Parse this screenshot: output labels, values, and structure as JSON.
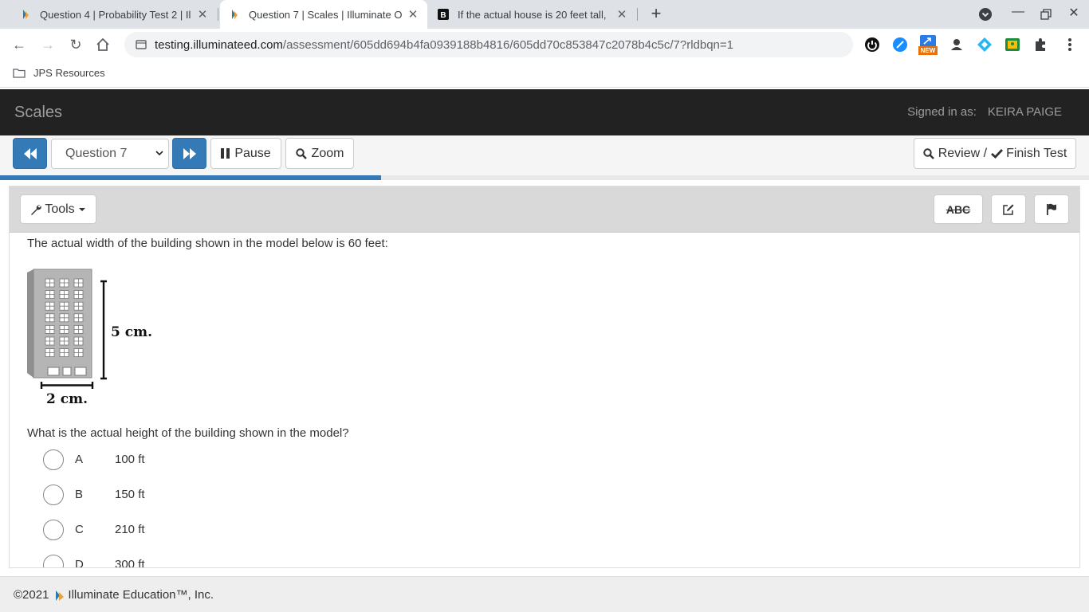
{
  "browser": {
    "tabs": [
      {
        "title": "Question 4 | Probability Test 2 | Il",
        "active": false
      },
      {
        "title": "Question 7 | Scales | Illuminate O",
        "active": true
      },
      {
        "title": "If the actual house is 20 feet tall,",
        "active": false
      }
    ],
    "url_domain": "testing.illuminateed.com",
    "url_path": "/assessment/605dd694b4fa0939188b4816/605dd70c853847c2078b4c5c/7?rldbqn=1",
    "bookmarks": [
      {
        "label": "JPS Resources"
      }
    ],
    "extension_badge": "NEW"
  },
  "app": {
    "title": "Scales",
    "signed_in_label": "Signed in as:",
    "user_name": "KEIRA PAIGE",
    "accent_color": "#337ab7",
    "header_color": "#222222"
  },
  "question_nav": {
    "current_question": "Question 7",
    "pause_label": "Pause",
    "zoom_label": "Zoom",
    "review_label": "Review /",
    "finish_label": "Finish Test",
    "progress_fraction": 0.35
  },
  "tools": {
    "tools_label": "Tools",
    "abc_label": "ABC"
  },
  "question": {
    "intro": "The actual width of the building shown in the model below is 60 feet:",
    "figure_height_label": "5 cm.",
    "figure_width_label": "2 cm.",
    "prompt": "What is the actual height of the building shown in the model?",
    "choices": [
      {
        "letter": "A",
        "text": "100 ft"
      },
      {
        "letter": "B",
        "text": "150 ft"
      },
      {
        "letter": "C",
        "text": "210 ft"
      },
      {
        "letter": "D",
        "text": "300 ft"
      }
    ]
  },
  "footer": {
    "copyright": "©2021",
    "company": "Illuminate Education™, Inc."
  }
}
